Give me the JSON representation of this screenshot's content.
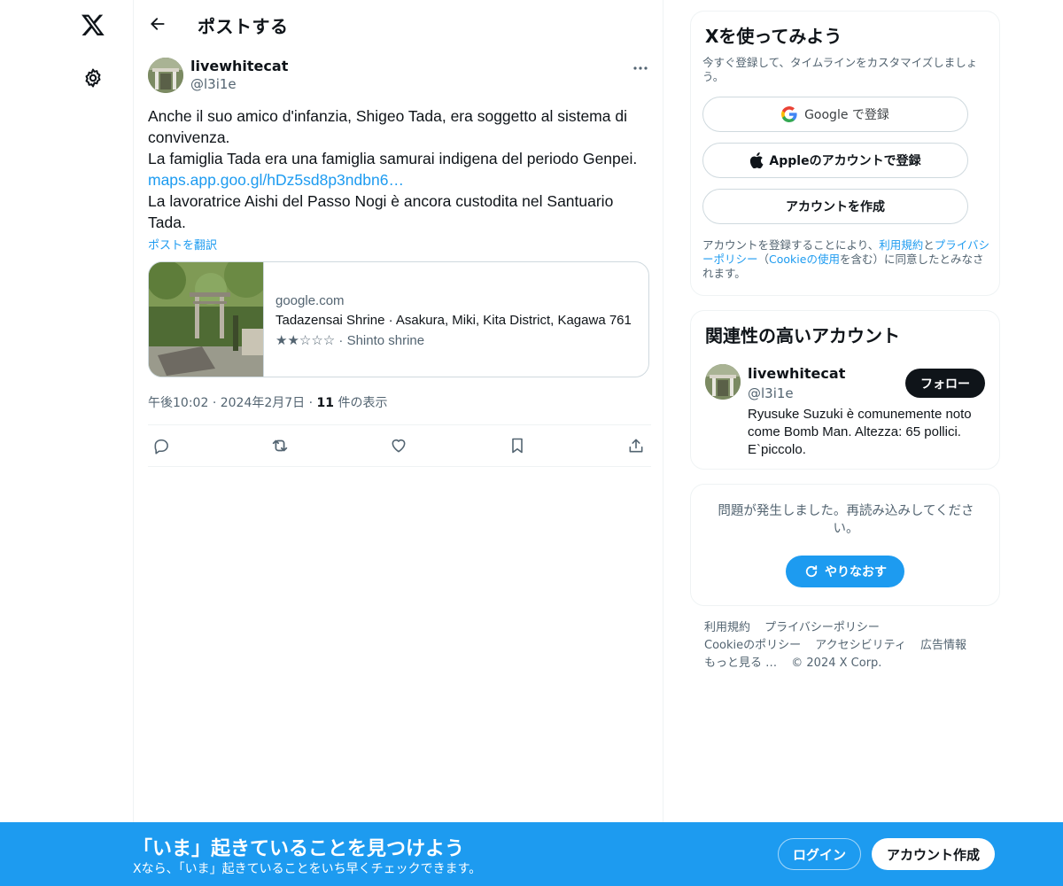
{
  "nav": {
    "logo_icon": "x-logo-icon",
    "settings_icon": "gear-icon"
  },
  "header": {
    "title": "ポストする",
    "back_icon": "arrow-left-icon"
  },
  "post": {
    "author_name": "livewhitecat",
    "author_handle": "@l3i1e",
    "lines": [
      "Anche il suo amico d'infanzia, Shigeo Tada, era soggetto al sistema di",
      "convivenza.",
      "La famiglia Tada era una famiglia samurai indigena del periodo Genpei.",
      "La lavoratrice Aishi del Passo Nogi è ancora custodita nel Santuario",
      "Tada."
    ],
    "link": "maps.app.goo.gl/hDz5sd8p3ndbn6…",
    "translate": "ポストを翻訳",
    "card": {
      "domain": "google.com",
      "title": "Tadazensai Shrine · Asakura, Miki, Kita District, Kagawa 761",
      "desc": "★★☆☆☆ · Shinto shrine"
    },
    "time": "午後10:02",
    "date": "2024年2月7日",
    "views_count": "11",
    "views_label": "件の表示",
    "sep": "·"
  },
  "signup": {
    "title": "Xを使ってみよう",
    "subtitle": "今すぐ登録して、タイムラインをカスタマイズしましょう。",
    "google_text": "Google で登録",
    "apple_text": "Appleのアカウントで登録",
    "create_text": "アカウントを作成",
    "terms_1": "アカウントを登録することにより、",
    "terms_link1": "利用規約",
    "terms_2": "と",
    "terms_link2": "プライバシーポリシー",
    "terms_3": "（",
    "terms_link3": "Cookieの使用",
    "terms_4": "を含む）に同意したとみなされます。"
  },
  "related": {
    "title": "関連性の高いアカウント",
    "name": "livewhitecat",
    "handle": "@l3i1e",
    "follow": "フォロー",
    "bio": "Ryusuke Suzuki è comunemente noto come Bomb Man. Altezza: 65 pollici. E`piccolo."
  },
  "error": {
    "message": "問題が発生しました。再読み込みしてください。",
    "retry": "やりなおす"
  },
  "footer": {
    "links": [
      "利用規約",
      "プライバシーポリシー",
      "Cookieのポリシー",
      "アクセシビリティ",
      "広告情報",
      "もっと見る …"
    ],
    "copyright": "© 2024 X Corp."
  },
  "banner": {
    "title": "「いま」起きていることを見つけよう",
    "subtitle": "Xなら、「いま」起きていることをいち早くチェックできます。",
    "login": "ログイン",
    "signup": "アカウント作成"
  },
  "colors": {
    "accent": "#1d9bf0",
    "text": "#0f1419",
    "muted": "#536471",
    "border": "#eff3f4"
  }
}
